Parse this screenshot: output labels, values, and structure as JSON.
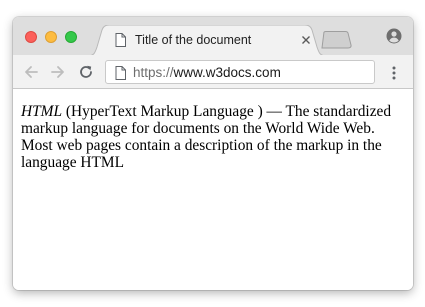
{
  "window": {
    "traffic_lights": [
      {
        "name": "close",
        "color": "#fc605b"
      },
      {
        "name": "minimize",
        "color": "#fdbc40"
      },
      {
        "name": "zoom",
        "color": "#34c84a"
      }
    ]
  },
  "tab": {
    "title": "Title of the document",
    "icon": "document-icon",
    "close_icon": "close-icon"
  },
  "tabstrip": {
    "new_tab_icon": "new-tab-icon",
    "profile_icon": "profile-icon"
  },
  "toolbar": {
    "back_icon": "back-arrow-icon",
    "forward_icon": "forward-arrow-icon",
    "reload_icon": "reload-icon",
    "menu_icon": "more-vertical-icon",
    "address": {
      "scheme": "https://",
      "host": "www.w3docs.com",
      "page_icon": "page-info-icon"
    }
  },
  "page": {
    "term": "HTML",
    "definition": " (HyperText Markup Language ) — The standardized markup language for documents on the World Wide Web. Most web pages contain a description of the markup in the language HTML"
  },
  "colors": {
    "tabstrip_bg": "#dedede",
    "toolbar_bg": "#f2f2f2",
    "active_tab_bg": "#f2f2f2"
  }
}
